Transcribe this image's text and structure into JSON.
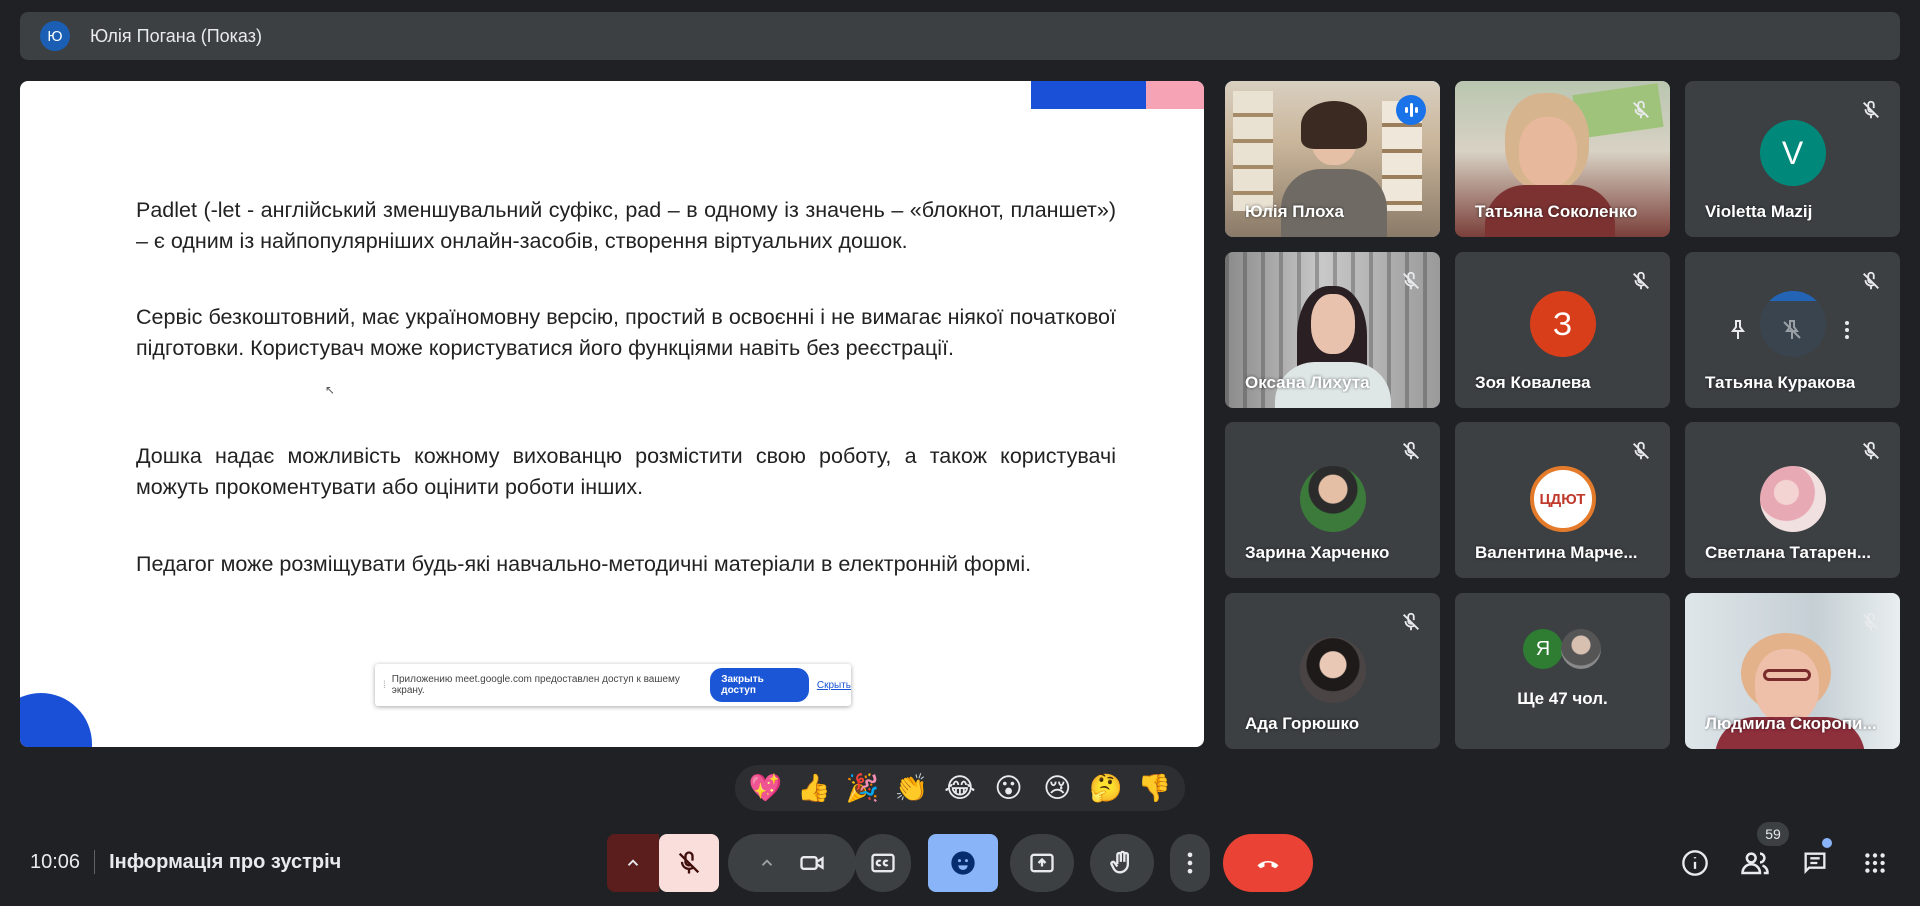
{
  "presenter": {
    "initial": "Ю",
    "label": "Юлія Погана (Показ)"
  },
  "slide": {
    "paragraphs": [
      "Padlet (-let - англійський зменшувальний суфікс, pad – в одному із значень – «блокнот, планшет») – є одним із найпопулярніших онлайн-засобів, створення віртуальних дошок.",
      "Сервіс безкоштовний, має україномовну версію, простий в освоєнні і не вимагає ніякої початкової підготовки. Користувач може користуватися його функціями навіть без реєстрації.",
      "Дошка надає можливість кожному вихованцю розмістити свою роботу, а також користувачі можуть прокоментувати або оцінити роботи інших.",
      "Педагог може розміщувати будь-які навчально-методичні матеріали в електронній формі."
    ],
    "share_bar": {
      "message": "Приложению meet.google.com предоставлен доступ к вашему экрану.",
      "stop_label": "Закрыть доступ",
      "hide_label": "Скрыть"
    },
    "colors": {
      "blue": "#1a4fd8",
      "pink": "#f5a3b5"
    }
  },
  "participants": [
    {
      "name": "Юлія Плоха",
      "type": "video",
      "speaking": true
    },
    {
      "name": "Татьяна Соколенко",
      "type": "video",
      "muted": true
    },
    {
      "name": "Violetta Mazij",
      "type": "letter",
      "initial": "V",
      "color": "#00897b",
      "muted": true
    },
    {
      "name": "Оксана Лихута",
      "type": "video",
      "muted": true
    },
    {
      "name": "Зоя Ковалева",
      "type": "letter",
      "initial": "З",
      "color": "#d93e1a",
      "muted": true
    },
    {
      "name": "Татьяна Куракова",
      "type": "hover",
      "muted": true
    },
    {
      "name": "Зарина Харченко",
      "type": "photo",
      "muted": true
    },
    {
      "name": "Валентина Марче...",
      "type": "photo",
      "badge_text": "ЦДЮТ",
      "muted": true
    },
    {
      "name": "Светлана Татарен...",
      "type": "photo",
      "muted": true
    },
    {
      "name": "Ада Горюшко",
      "type": "photo",
      "muted": true
    },
    {
      "name": "Ще 47 чол.",
      "type": "more",
      "initial": "Я"
    },
    {
      "name": "Людмила Скоропи...",
      "type": "video",
      "muted": true
    }
  ],
  "reactions": [
    "💖",
    "👍",
    "🎉",
    "👏",
    "😂",
    "😮",
    "😢",
    "🤔",
    "👎"
  ],
  "bottom": {
    "time": "10:06",
    "meeting_info": "Інформація про зустріч",
    "people_count": "59"
  }
}
